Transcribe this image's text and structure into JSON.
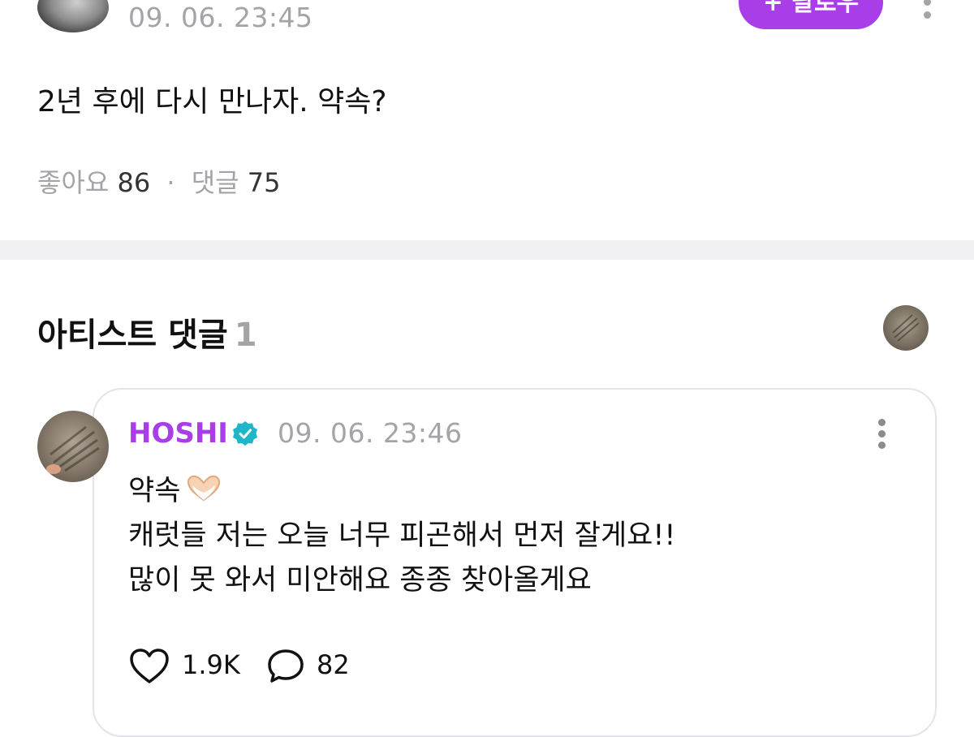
{
  "post": {
    "timestamp": "09. 06. 23:45",
    "follow_label": "+ 팔로우",
    "body": "2년 후에 다시 만나자. 약속?",
    "likes_label": "좋아요",
    "likes_count": "86",
    "separator": "·",
    "comments_label": "댓글",
    "comments_count": "75"
  },
  "artist_comments": {
    "title": "아티스트 댓글",
    "count": "1"
  },
  "comment": {
    "author": "HOSHI",
    "timestamp": "09. 06. 23:46",
    "lines": [
      "약속",
      "캐럿들 저는 오늘 너무 피곤해서 먼저 잘게요!!",
      "많이 못 와서 미안해요 종종 찾아올게요"
    ],
    "likes": "1.9K",
    "replies": "82"
  },
  "colors": {
    "accent": "#a93ee8",
    "verified": "#1fb6c9",
    "muted": "#a3a3a8",
    "divider": "#f1f1f3",
    "card_border": "#e3e3ea"
  },
  "icons": {
    "more": "more-vertical-icon",
    "verified": "verified-badge-icon",
    "heart_hands": "heart-hands-emoji",
    "like": "heart-outline-icon",
    "reply": "speech-bubble-icon"
  }
}
